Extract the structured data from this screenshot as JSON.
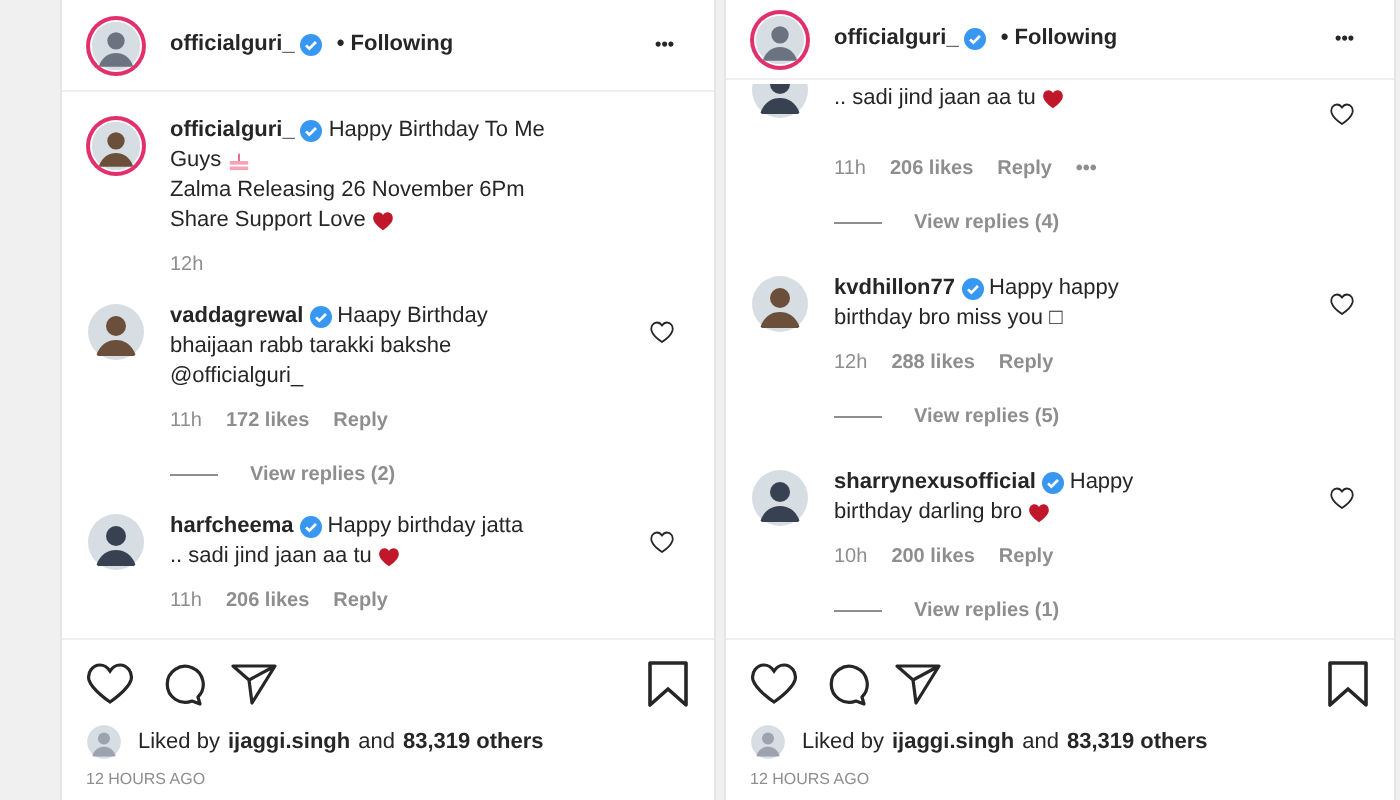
{
  "panels": [
    {
      "header": {
        "username": "officialguri_",
        "verified": true,
        "follow": "• Following",
        "more": "•••"
      },
      "comments": [
        {
          "kind": "caption",
          "username": "officialguri_",
          "verified": true,
          "lines": [
            {
              "text": "Happy Birthday To Me"
            },
            {
              "text": "Guys",
              "cake": true
            },
            {
              "text": "Zalma Releasing 26 November 6Pm"
            },
            {
              "text": "Share Support Love",
              "heart": true
            }
          ],
          "time": "12h"
        },
        {
          "kind": "comment",
          "username": "vaddagrewal",
          "verified": true,
          "lines": [
            {
              "text": "Haapy Birthday"
            },
            {
              "text": "bhaijaan rabb tarakki bakshe"
            },
            {
              "text": "@officialguri_"
            }
          ],
          "time": "11h",
          "likes": "172 likes",
          "reply": "Reply",
          "view_replies": "View replies (2)"
        },
        {
          "kind": "comment",
          "username": "harfcheema",
          "verified": true,
          "lines": [
            {
              "text": "Happy birthday jatta"
            },
            {
              "text": ".. sadi jind jaan aa tu",
              "heart": true
            }
          ],
          "time": "11h",
          "likes": "206 likes",
          "reply": "Reply"
        }
      ],
      "liked_by": {
        "prefix": "Liked by",
        "user": "ijaggi.singh",
        "and": "and",
        "others": "83,319 others"
      },
      "posted": "12 HOURS AGO"
    },
    {
      "header": {
        "username": "officialguri_",
        "verified": true,
        "follow": "• Following",
        "more": "•••"
      },
      "comments": [
        {
          "kind": "cut",
          "lines": [
            {
              "text": ".. sadi jind jaan aa tu",
              "heart": true
            }
          ],
          "time": "11h",
          "likes": "206 likes",
          "reply": "Reply",
          "more": "•••",
          "view_replies": "View replies (4)"
        },
        {
          "kind": "comment",
          "username": "kvdhillon77",
          "verified": true,
          "lines": [
            {
              "text": "Happy happy"
            },
            {
              "text": "birthday bro miss you □"
            }
          ],
          "time": "12h",
          "likes": "288 likes",
          "reply": "Reply",
          "view_replies": "View replies (5)"
        },
        {
          "kind": "comment",
          "username": "sharrynexusofficial",
          "verified": true,
          "lines": [
            {
              "text": "Happy"
            },
            {
              "text": "birthday darling bro",
              "heart": true
            }
          ],
          "time": "10h",
          "likes": "200 likes",
          "reply": "Reply",
          "view_replies": "View replies (1)"
        }
      ],
      "liked_by": {
        "prefix": "Liked by",
        "user": "ijaggi.singh",
        "and": "and",
        "others": "83,319 others"
      },
      "posted": "12 HOURS AGO"
    }
  ]
}
